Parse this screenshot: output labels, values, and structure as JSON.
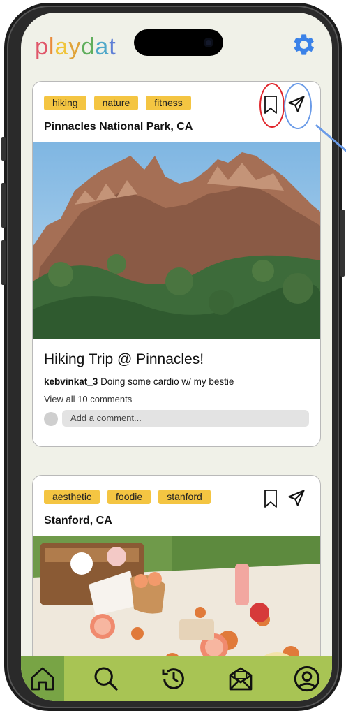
{
  "app": {
    "logo_letters": [
      "p",
      "l",
      "a",
      "y",
      "d",
      "a",
      "t"
    ]
  },
  "posts": [
    {
      "tags": [
        "hiking",
        "nature",
        "fitness"
      ],
      "location": "Pinnacles National Park, CA",
      "title": "Hiking Trip @ Pinnacles!",
      "username": "kebvinkat_3",
      "caption": "Doing some cardio w/ my bestie",
      "view_comments": "View all 10 comments",
      "comment_placeholder": "Add a comment..."
    },
    {
      "tags": [
        "aesthetic",
        "foodie",
        "stanford"
      ],
      "location": "Stanford, CA"
    }
  ],
  "nav": [
    "home-icon",
    "search-icon",
    "history-icon",
    "inbox-icon",
    "profile-icon"
  ],
  "colors": {
    "tag": "#f4c542",
    "nav": "#a8c454",
    "nav_active": "#78a445",
    "settings": "#3b82e8",
    "bookmark_highlight": "#e0252b",
    "share_highlight": "#6a9be8"
  }
}
